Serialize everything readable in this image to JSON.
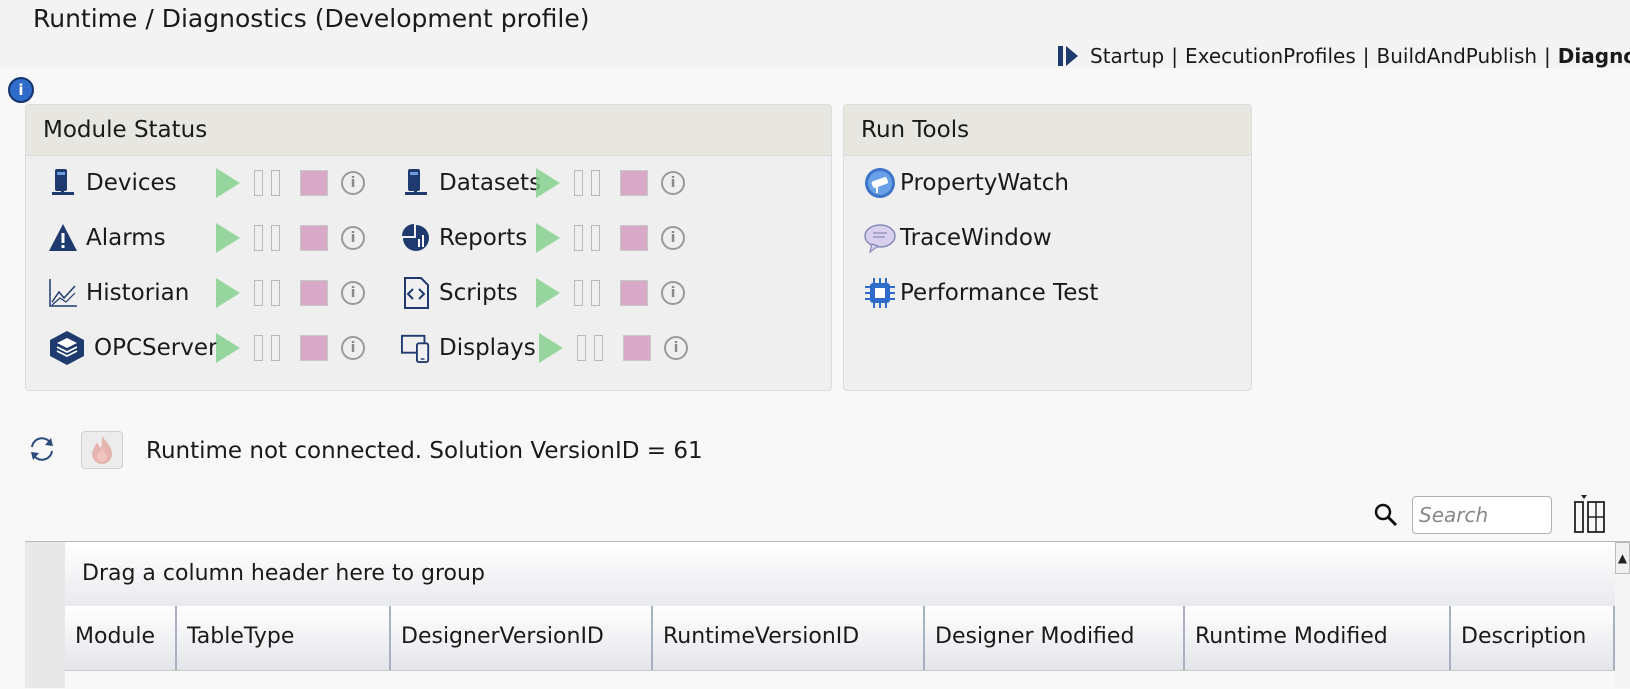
{
  "title": "Runtime / Diagnostics (Development profile)",
  "breadcrumb": {
    "items": [
      "Startup",
      "ExecutionProfiles",
      "BuildAndPublish"
    ],
    "current": "Diagnost",
    "separator": "|"
  },
  "module_status": {
    "header": "Module Status",
    "left": [
      {
        "label": "Devices",
        "icon": "server-icon"
      },
      {
        "label": "Alarms",
        "icon": "warning-icon"
      },
      {
        "label": "Historian",
        "icon": "chart-line-icon"
      },
      {
        "label": "OPCServer",
        "icon": "opc-layers-icon"
      }
    ],
    "right": [
      {
        "label": "Datasets",
        "icon": "server-icon"
      },
      {
        "label": "Reports",
        "icon": "pie-chart-icon"
      },
      {
        "label": "Scripts",
        "icon": "code-file-icon"
      },
      {
        "label": "Displays",
        "icon": "devices-icon"
      }
    ],
    "info_glyph": "i"
  },
  "run_tools": {
    "header": "Run Tools",
    "items": [
      {
        "label": "PropertyWatch",
        "icon": "telescope-icon"
      },
      {
        "label": "TraceWindow",
        "icon": "speech-bubble-icon"
      },
      {
        "label": "Performance Test",
        "icon": "chip-icon"
      }
    ]
  },
  "status": {
    "text": "Runtime not connected. Solution VersionID = 61"
  },
  "search": {
    "placeholder": "Search"
  },
  "grid": {
    "group_hint": "Drag a column header here to group",
    "columns": [
      "Module",
      "TableType",
      "DesignerVersionID",
      "RuntimeVersionID",
      "Designer Modified",
      "Runtime Modified",
      "Description"
    ]
  },
  "colors": {
    "accent": "#2f6bc8",
    "play": "#7fcf8a",
    "stop": "#d9a9c8",
    "icon_navy": "#1f3a6e"
  }
}
